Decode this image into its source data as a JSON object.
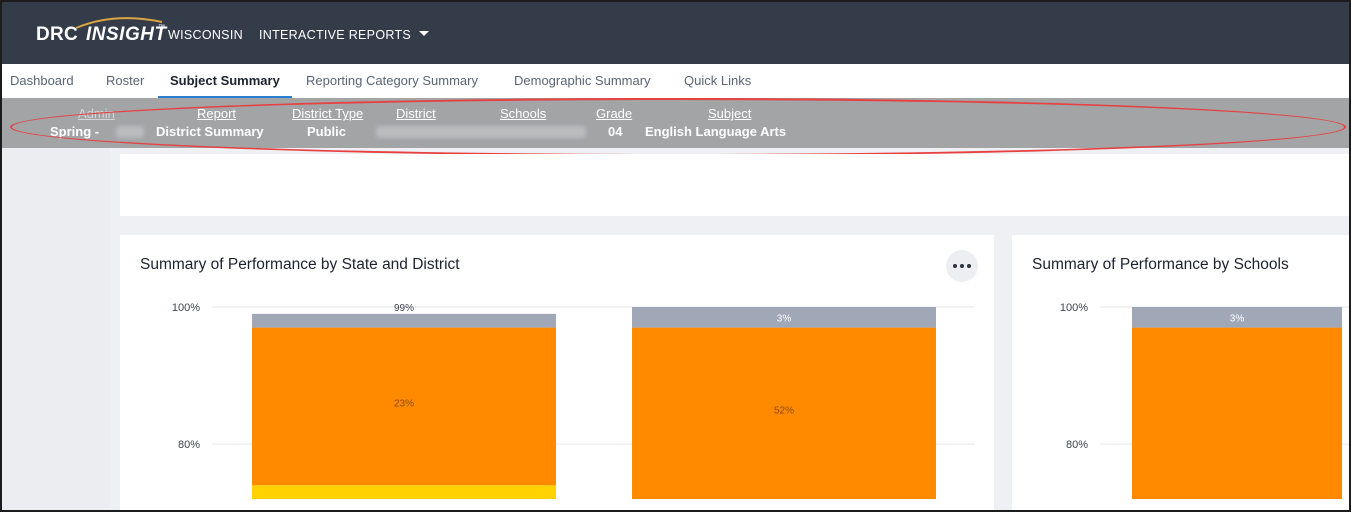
{
  "header": {
    "brand_drc": "DRC",
    "brand_insight": "INSIGHT",
    "brand_tm": "™",
    "state": "WISCONSIN",
    "reports_menu": "INTERACTIVE REPORTS"
  },
  "tabs": [
    {
      "label": "Dashboard"
    },
    {
      "label": "Roster"
    },
    {
      "label": "Subject Summary",
      "active": true
    },
    {
      "label": "Reporting Category Summary"
    },
    {
      "label": "Demographic Summary"
    },
    {
      "label": "Quick Links"
    }
  ],
  "filters": {
    "admin": {
      "label": "Admin",
      "value": "Spring -"
    },
    "report": {
      "label": "Report",
      "value": "District Summary"
    },
    "district_type": {
      "label": "District Type",
      "value": "Public"
    },
    "district": {
      "label": "District",
      "value": ""
    },
    "schools": {
      "label": "Schools",
      "value": ""
    },
    "grade": {
      "label": "Grade",
      "value": "04"
    },
    "subject": {
      "label": "Subject",
      "value": "English Language Arts"
    }
  },
  "colors": {
    "topbar": "#343c4a",
    "filterbar": "#a2a4a6",
    "highlight_circle": "#e84040",
    "tab_underline": "#2a7fd4",
    "gray_level": "#a0a8b8",
    "orange_level": "#ff8a00",
    "yellow_level": "#ffd200"
  },
  "cards": {
    "left_title": "Summary of Performance by State and District",
    "right_title": "Summary of Performance by Schools",
    "menu_icon": "more-horizontal-icon"
  },
  "chart_data": [
    {
      "type": "bar",
      "title": "Summary of Performance by State and District",
      "ylim": [
        72,
        100
      ],
      "yticks": [
        100,
        80
      ],
      "ytick_labels": [
        "100%",
        "80%"
      ],
      "grid": true,
      "bars": [
        {
          "segments": [
            {
              "color": "#ffd200",
              "from": 0,
              "to": 74
            },
            {
              "color": "#ff8a00",
              "from": 74,
              "to": 97,
              "label": "23%"
            },
            {
              "color": "#a0a8b8",
              "from": 97,
              "to": 99
            }
          ],
          "top_label": "99%"
        },
        {
          "segments": [
            {
              "color": "#ff8a00",
              "from": 45,
              "to": 97,
              "label": "52%"
            },
            {
              "color": "#a0a8b8",
              "from": 97,
              "to": 100,
              "label": "3%"
            }
          ]
        }
      ]
    },
    {
      "type": "bar",
      "title": "Summary of Performance by Schools",
      "ylim": [
        72,
        100
      ],
      "yticks": [
        100,
        80
      ],
      "ytick_labels": [
        "100%",
        "80%"
      ],
      "grid": true,
      "bars": [
        {
          "segments": [
            {
              "color": "#ff8a00",
              "from": 45,
              "to": 97
            },
            {
              "color": "#a0a8b8",
              "from": 97,
              "to": 100,
              "label": "3%"
            }
          ]
        }
      ]
    }
  ]
}
